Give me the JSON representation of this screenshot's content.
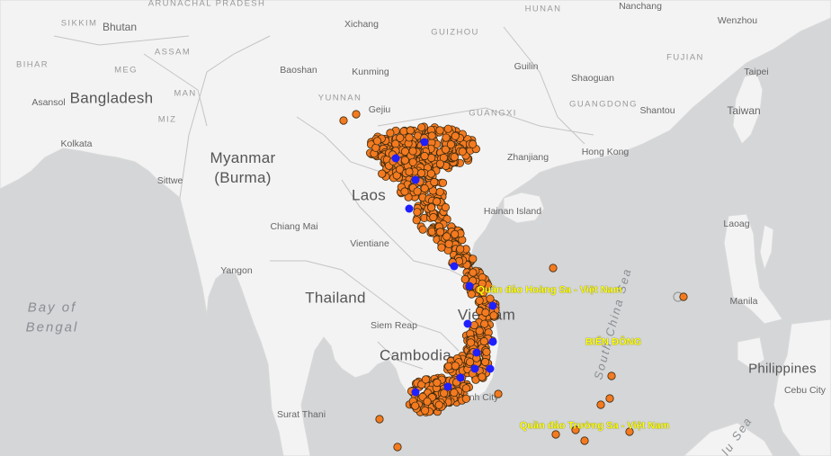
{
  "countries": [
    {
      "id": "bangladesh",
      "name": "Bangladesh"
    },
    {
      "id": "myanmar",
      "name": "Myanmar\n(Burma)"
    },
    {
      "id": "laos",
      "name": "Laos"
    },
    {
      "id": "thailand",
      "name": "Thailand"
    },
    {
      "id": "cambodia",
      "name": "Cambodia"
    },
    {
      "id": "vietnam",
      "name": "Vietnam"
    },
    {
      "id": "philippines",
      "name": "Philippines"
    },
    {
      "id": "bhutan",
      "name": "Bhutan"
    },
    {
      "id": "taiwan",
      "name": "Taiwan"
    }
  ],
  "regions": [
    "ARUNACHAL PRADESH",
    "HUNAN",
    "GUIZHOU",
    "FUJIAN",
    "YUNNAN",
    "GUANGXI",
    "GUANGDONG",
    "ASSAM",
    "MEG",
    "BIHAR",
    "MAN",
    "MIZ",
    "SIKKIM"
  ],
  "cities": [
    "Nanchang",
    "Wenzhou",
    "Xichang",
    "Baoshan",
    "Kunming",
    "Guilin",
    "Shaoguan",
    "Taipei",
    "Gejiu",
    "Shantou",
    "Asansol",
    "Kolkata",
    "Sittwe",
    "Zhanjiang",
    "Hong Kong",
    "Hainan Island",
    "Chiang Mai",
    "Vientiane",
    "Laoag",
    "Yangon",
    "Manila",
    "Siem Reap",
    "Cebu City",
    "Surat Thani",
    "Ho Chi Minh City"
  ],
  "seas": {
    "bay": "Bay of\nBengal",
    "scs1": "South China Sea",
    "scs2": "lu Sea"
  },
  "annotations": {
    "hoang_sa": "Quần đảo Hoàng Sa - Việt Nam",
    "bien_dong": "BIỂN ĐÔNG",
    "truong_sa": "Quần đảo Trường Sa - Việt Nam"
  },
  "markers": {
    "orange_color": "#f47a20",
    "blue_color": "#1f1fff",
    "outline": "#3a2a10"
  },
  "colors": {
    "land": "#f2f2f2",
    "water": "#d4d6d8",
    "border": "#b8b8b8"
  }
}
